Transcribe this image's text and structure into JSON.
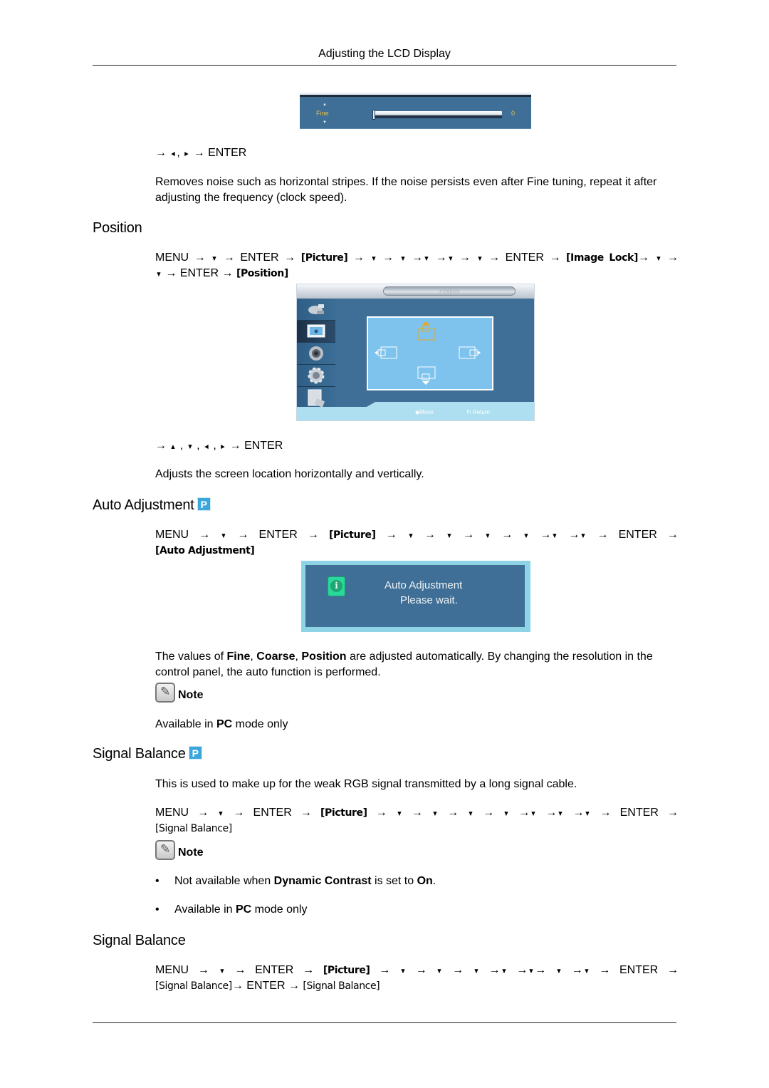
{
  "page": {
    "header_title": "Adjusting the LCD Display"
  },
  "fine_section": {
    "osd": {
      "label": "Fine",
      "value": "0",
      "slider_fraction": 0.0
    },
    "nav_keys": {
      "arrow": "→",
      "left": "◄",
      "sep": ",",
      "right": "►",
      "enter": "ENTER"
    },
    "description": "Removes noise such as horizontal stripes. If the noise persists even after Fine tuning, repeat it after adjusting the frequency (clock speed)."
  },
  "position_section": {
    "heading": "Position",
    "menu_path_line1": {
      "menu": "MENU",
      "enter": "ENTER",
      "picture": "[Picture]",
      "image_lock": "[Image Lock]"
    },
    "menu_path_line2": {
      "enter": "ENTER",
      "position": "[Position]"
    },
    "osd": {
      "title": "Position",
      "sidebar_icons": [
        "input-icon",
        "picture-icon",
        "sound-icon",
        "setup-icon",
        "multi-control-icon"
      ],
      "active_sidebar_index": 1,
      "move_hint": "Move",
      "return_hint": "Return",
      "colors": {
        "panel": "#3f6f96",
        "frame": "#7ec3ee",
        "selected": "#e8a91c",
        "bar": "#aedff0"
      }
    },
    "nav_keys": {
      "arrow": "→",
      "up": "▲",
      "down": "▼",
      "left": "◄",
      "right": "►",
      "sep": ",",
      "enter": "ENTER"
    },
    "description": "Adjusts the screen location horizontally and vertically."
  },
  "auto_adjustment_section": {
    "heading": "Auto Adjustment",
    "badge": "P",
    "menu_path": {
      "menu": "MENU",
      "enter": "ENTER",
      "picture": "[Picture]",
      "target": "[Auto Adjustment]"
    },
    "osd": {
      "line1": "Auto Adjustment",
      "line2": "Please wait.",
      "icon": "i"
    },
    "description": {
      "pre": "The values of ",
      "fine": "Fine",
      "sep1": ", ",
      "coarse": "Coarse",
      "sep2": ", ",
      "position": "Position",
      "post": " are adjusted automatically. By changing the resolution in the control panel, the auto function is performed."
    },
    "note_label": "Note",
    "note_text": {
      "pre": "Available in ",
      "pc": "PC",
      "post": " mode only"
    }
  },
  "signal_balance_section": {
    "heading": "Signal Balance",
    "badge": "P",
    "description": "This is used to make up for the weak RGB signal transmitted by a long signal cable.",
    "menu_path": {
      "menu": "MENU",
      "enter": "ENTER",
      "picture": "[Picture]",
      "target": "[Signal Balance]"
    },
    "note_label": "Note",
    "bullets": [
      {
        "pre": "Not available when ",
        "bold1": "Dynamic Contrast",
        "mid": " is set to ",
        "bold2": "On",
        "post": "."
      },
      {
        "pre": "Available in ",
        "bold1": "PC",
        "mid": " mode only",
        "bold2": "",
        "post": ""
      }
    ],
    "bullet_char": "•"
  },
  "signal_balance_sub_section": {
    "heading": "Signal Balance",
    "menu_path": {
      "menu": "MENU",
      "enter": "ENTER",
      "picture": "[Picture]",
      "target": "[Signal Balance]",
      "enter2": "ENTER",
      "target2": "[Signal Balance]"
    }
  },
  "glyphs": {
    "arrow": "→",
    "down": "▼"
  }
}
